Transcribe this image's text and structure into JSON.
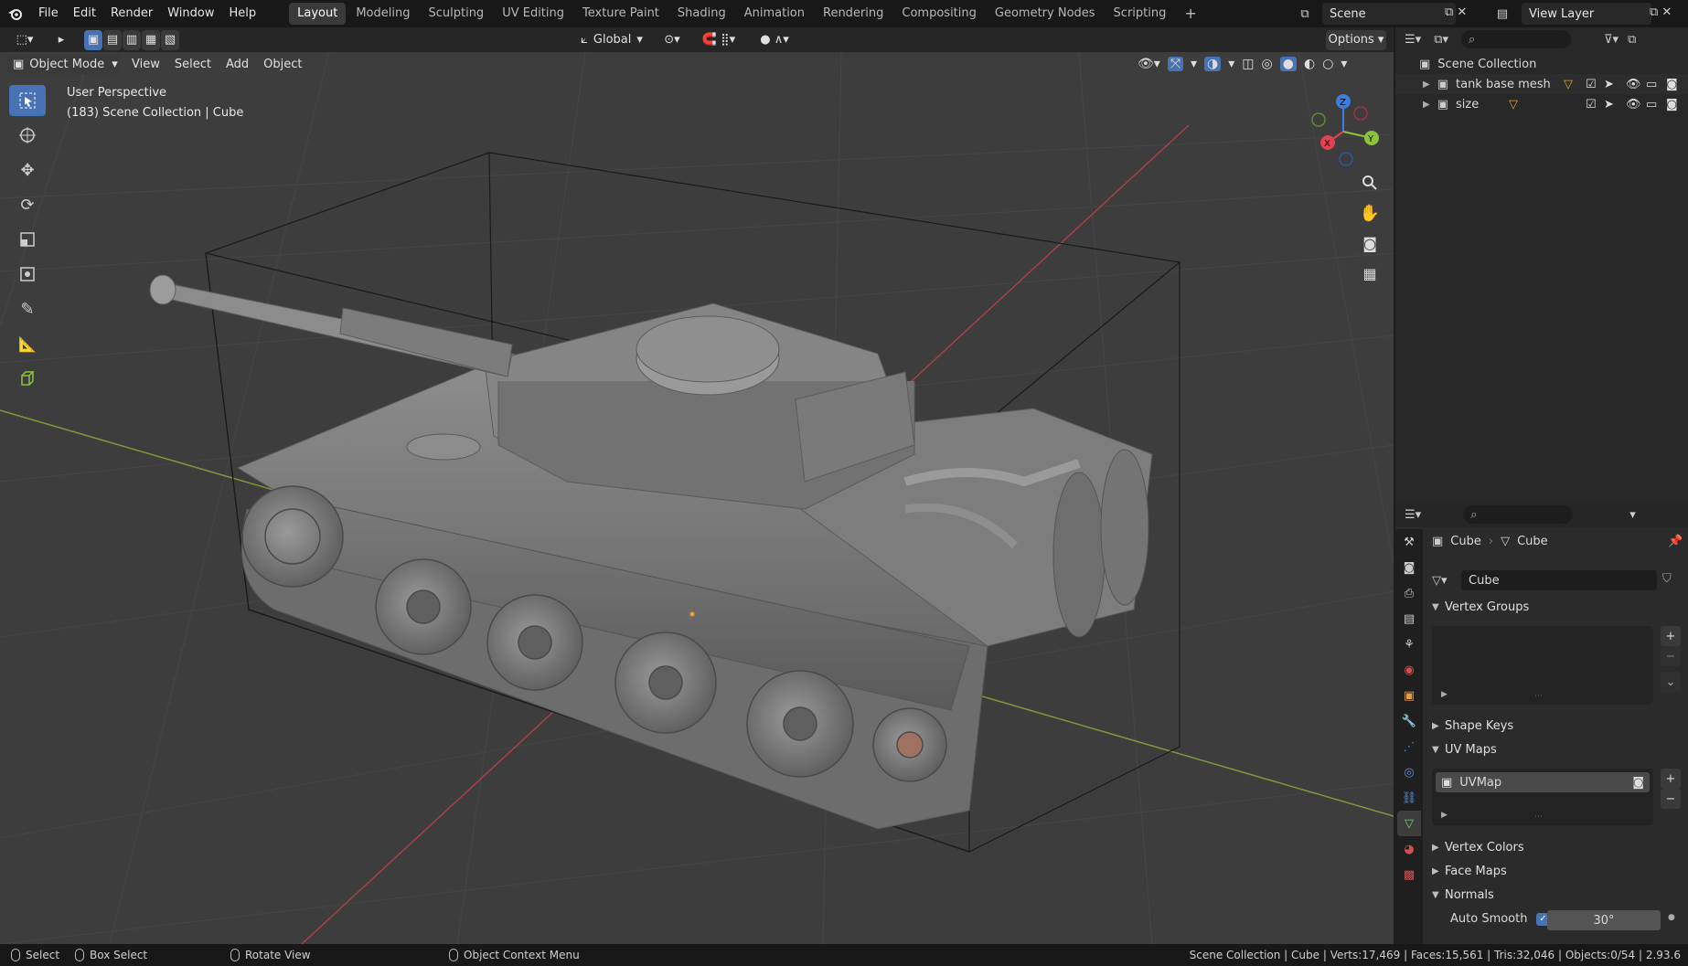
{
  "topbar": {
    "menus": [
      "File",
      "Edit",
      "Render",
      "Window",
      "Help"
    ],
    "workspaces": [
      "Layout",
      "Modeling",
      "Sculpting",
      "UV Editing",
      "Texture Paint",
      "Shading",
      "Animation",
      "Rendering",
      "Compositing",
      "Geometry Nodes",
      "Scripting"
    ],
    "active_workspace": "Layout",
    "scene": "Scene",
    "view_layer": "View Layer"
  },
  "viewport_header": {
    "transform_orientation": "Global",
    "options_label": "Options",
    "mode": "Object Mode",
    "menus": [
      "View",
      "Select",
      "Add",
      "Object"
    ]
  },
  "viewport": {
    "perspective": "User Perspective",
    "context": "(183) Scene Collection | Cube",
    "gizmo_axes": {
      "x": "X",
      "y": "Y",
      "z": "Z"
    }
  },
  "outliner": {
    "root": "Scene Collection",
    "items": [
      {
        "label": "tank base mesh"
      },
      {
        "label": "size"
      }
    ]
  },
  "properties": {
    "breadcrumb_object": "Cube",
    "breadcrumb_data": "Cube",
    "data_name": "Cube",
    "sections": {
      "vertex_groups": "Vertex Groups",
      "shape_keys": "Shape Keys",
      "uv_maps": "UV Maps",
      "vertex_colors": "Vertex Colors",
      "face_maps": "Face Maps",
      "normals": "Normals"
    },
    "uvmap_item": "UVMap",
    "auto_smooth_label": "Auto Smooth",
    "auto_smooth_angle": "30°"
  },
  "statusbar": {
    "select": "Select",
    "box_select": "Box Select",
    "rotate_view": "Rotate View",
    "context_menu": "Object Context Menu",
    "stats": "Scene Collection | Cube | Verts:17,469 | Faces:15,561 | Tris:32,046 | Objects:0/54 | 2.93.6"
  },
  "colors": {
    "accent": "#4772b3",
    "viewport_bg": "#3d3d3d",
    "axis_x": "#e0404f",
    "axis_y": "#8bc43a",
    "axis_z": "#3b7de0"
  }
}
